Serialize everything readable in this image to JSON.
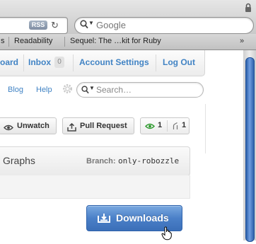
{
  "browser": {
    "url_bar": {
      "rss_badge": "RSS",
      "reload_icon": "reload-icon"
    },
    "search": {
      "placeholder": "Google",
      "icon": "search-icon"
    },
    "bookmarks": {
      "partial_item": "s",
      "items": [
        "Readability",
        "Sequel: The …kit for Ruby"
      ],
      "overflow": "»"
    }
  },
  "userbar": {
    "dashboard_label": "oard",
    "inbox_label": "Inbox",
    "inbox_count": "0",
    "account_settings_label": "Account Settings",
    "logout_label": "Log Out"
  },
  "nav": {
    "blog_label": "Blog",
    "help_label": "Help",
    "search_placeholder": "Search…"
  },
  "repo": {
    "unwatch_label": "Unwatch",
    "pull_request_label": "Pull Request",
    "watchers_count": "1",
    "forks_count": "1"
  },
  "tabs": {
    "graphs_label": "Graphs",
    "branch_label": "Branch:",
    "branch_name": "only-robozzle"
  },
  "downloads": {
    "label": "Downloads"
  },
  "colors": {
    "link": "#4183c4",
    "downloads_button": "#4b80c8",
    "watch_icon": "#2e9a2e",
    "scrollbar_thumb": "#3f72bd"
  }
}
